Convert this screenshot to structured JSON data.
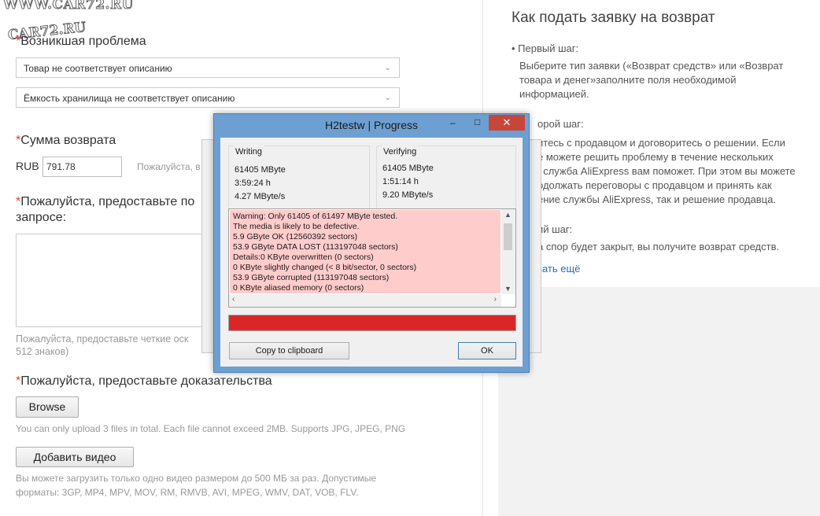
{
  "watermark": {
    "top": "WWW.CAR72.RU",
    "second": "CAR72.RU"
  },
  "form": {
    "problem_label": "Возникшая проблема",
    "problem_select_1": "Товар не соответствует описанию",
    "problem_select_2": "Ёмкость хранилища не соответствует описанию",
    "amount_label": "Сумма возврата",
    "currency": "RUB",
    "amount_value": "791.78",
    "amount_hint": "Пожалуйста, в",
    "details_label_1": "Пожалуйста, предоставьте по",
    "details_label_2": "запросе:",
    "details_hint_1": "Пожалуйста, предоставьте четкие оск",
    "details_hint_2": "512 знаков)",
    "evidence_label": "Пожалуйста, предоставьте доказательства",
    "browse_button": "Browse",
    "upload_hint": "You can only upload 3 files in total. Each file cannot exceed 2MB. Supports JPG, JPEG, PNG",
    "video_button": "Добавить видео",
    "video_hint_1": "Вы можете загрузить только одно видео размером до 500 МБ за раз. Допустимые",
    "video_hint_2": "форматы: 3GP, MP4, MPV, MOV, RM, RMVB, AVI, MPEG, WMV, DAT, VOB, FLV."
  },
  "sidebar": {
    "title": "Как подать заявку на возврат",
    "step1_title": "• Первый шаг:",
    "step1_lines": [
      "Выберите тип заявки («Возврат средств» или «Возврат",
      "товара и денег»заполните поля необходимой",
      "информацией."
    ],
    "step2_title": "орой шаг:",
    "step2_lines": [
      "итесь с продавцом и договоритесь о решении. Если",
      "е можете решить проблему в течение нескольких",
      ", служба AliExpress вам поможет. При этом вы можете",
      "одолжать переговоры с продавцом и принять как",
      "ение службы AliExpress, так и решение продавца."
    ],
    "step3_title": "ий шаг:",
    "step3_line": "а спор будет закрыт, вы получите возврат средств.",
    "more_link": "зать ещё"
  },
  "dialog": {
    "title": "H2testw | Progress",
    "writing": {
      "title": "Writing",
      "size": "61405 MByte",
      "time": "3:59:24 h",
      "speed": "4.27 MByte/s"
    },
    "verifying": {
      "title": "Verifying",
      "size": "61405 MByte",
      "time": "1:51:14 h",
      "speed": "9.20 MByte/s"
    },
    "log": [
      "Warning: Only 61405 of 61497 MByte tested.",
      "The media is likely to be defective.",
      "5.9 GByte OK (12560392 sectors)",
      "53.9 GByte DATA LOST (113197048 sectors)",
      "Details:0 KByte overwritten (0 sectors)",
      "0 KByte slightly changed (< 8 bit/sector, 0 sectors)",
      "53.9 GByte corrupted (113197048 sectors)",
      "0 KByte aliased memory (0 sectors)"
    ],
    "progress_fraction": 1.0,
    "copy_button": "Copy to clipboard",
    "ok_button": "OK"
  },
  "colors": {
    "required": "#e23b2e",
    "progress": "#da2626",
    "log_bg": "#ffcccc",
    "titlebar": "#6e9fd2"
  }
}
